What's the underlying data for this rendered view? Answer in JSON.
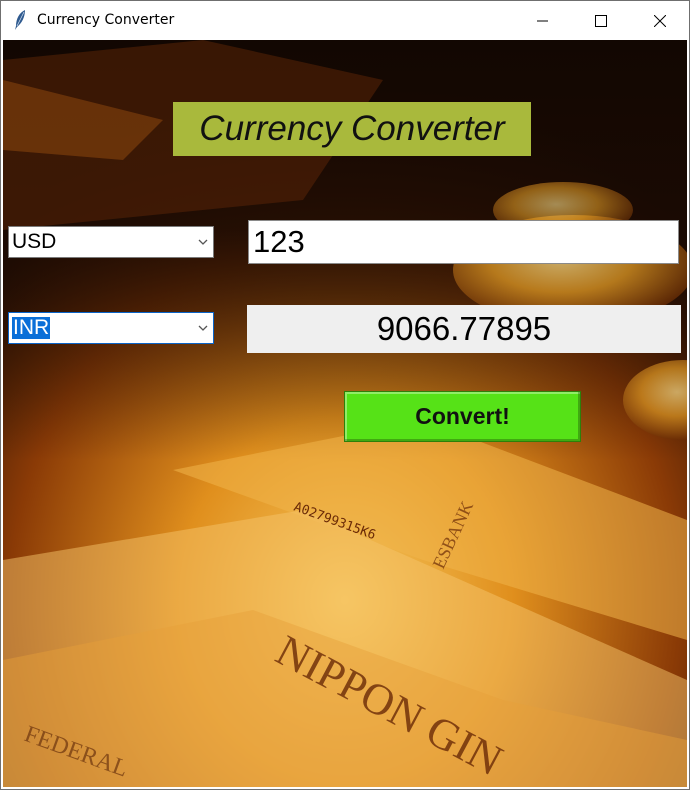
{
  "window": {
    "title": "Currency Converter",
    "icon": "feather-icon",
    "controls": [
      "minimize-icon",
      "maximize-icon",
      "close-icon"
    ]
  },
  "app": {
    "heading": "Currency Converter",
    "from_currency": "USD",
    "to_currency": "INR",
    "amount": "123",
    "result": "9066.77895",
    "convert_label": "Convert!"
  },
  "background": {
    "description_colors": [
      "#1a0a03",
      "#8a3a06",
      "#e08f1d",
      "#f6c75d"
    ]
  },
  "colors": {
    "heading_bg": "#a9b93c",
    "convert_bg": "#56e217",
    "result_bg": "#efefef",
    "selection": "#0a6fd8"
  }
}
